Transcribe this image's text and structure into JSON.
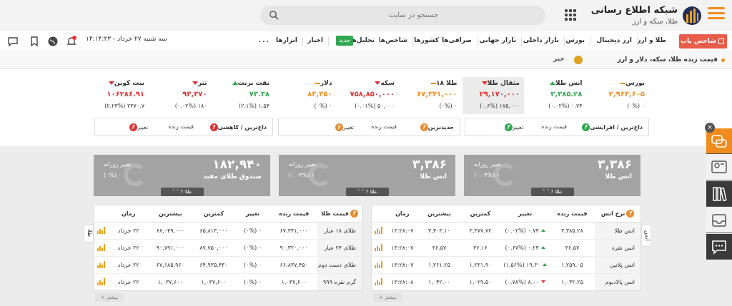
{
  "header": {
    "logo_title": "شبکه اطلاع رسانی",
    "logo_subtitle": "طلا، سکه و ارز",
    "search_placeholder": "جستجو در سایت"
  },
  "nav": {
    "shakhes_label": "شاخص یاب",
    "items": [
      "طلا و ارز",
      "ارز دیجیتال",
      "بورس",
      "بازار داخلی",
      "بازار جهانی",
      "صرافی‌ها",
      "کشورها",
      "شاخص‌ها",
      "تحلیل‌ها",
      "اخبار",
      "ابزارها"
    ],
    "new_badge": "جدید",
    "more": "...",
    "date": "سه شنبه ۲۷ خرداد - ۱۴:۱۴:۲۳"
  },
  "ticker": {
    "text": "قیمت زنده طلا، سکه، دلار و ارز",
    "news_label": "خبر"
  },
  "cards": [
    {
      "title": "بورس",
      "value": "۲,۹۶۳,۶۰۵",
      "sub": "(۰%) ۰",
      "dir": "flat"
    },
    {
      "title": "انس طلا",
      "value": "۳,۳۸۵.۲۸",
      "sub": "(۰.۰۲%) ۰.۷۴",
      "dir": "up"
    },
    {
      "title": "مثقال طلا",
      "value": "۲۹,۱۷۰,۰۰۰",
      "sub": "(۰.۶%) ۱۷۵,۰۰۰",
      "dir": "down",
      "selected": true
    },
    {
      "title": "طلا ۱۸",
      "value": "۶۷,۳۴۱,۰۰۰",
      "sub": "(۰%) ۰",
      "dir": "flat"
    },
    {
      "title": "سکه",
      "value": "۷۵۸,۸۵۰,۰۰۰",
      "sub": "(۰.۰۱%) ۵۰,۰۰۰",
      "dir": "down"
    },
    {
      "title": "دلار",
      "value": "۸۳,۳۵۰",
      "sub": "(۰%) ۰",
      "dir": "flat"
    },
    {
      "title": "نفت برنت",
      "value": "۷۳.۳۸",
      "sub": "(۲.۱%) ۱.۵۴",
      "dir": "up"
    },
    {
      "title": "تتر",
      "value": "۹۳,۳۷۰",
      "sub": "(۰.۰۲%) ۱۸۰",
      "dir": "down"
    },
    {
      "title": "بیت کوین",
      "value": "۱۰۶۲۸۶.۹۱",
      "sub": "(۲.۲۳%) ۲۳۷۰.۷",
      "dir": "down"
    }
  ],
  "filters": {
    "box1": {
      "title": "داغ‌ترین / افزایشی",
      "change": "تغییر",
      "price": "قیمت زنده"
    },
    "box2": {
      "title": "جدیدترین",
      "change": "تغییر",
      "price": "قیمت زنده"
    },
    "box3": {
      "title": "داغ‌ترین / کاهشی",
      "change": "تغییر",
      "price": "قیمت زنده"
    }
  },
  "big_cards": [
    {
      "value": "۳,۳۸۶",
      "name": "انس طلا",
      "label": "تغییر روزانه",
      "change": "(۰.۰۴%) ۱",
      "ctl": "طلا"
    },
    {
      "value": "۳,۳۸۶",
      "name": "انس طلا",
      "label": "تغییر روزانه",
      "change": "(۰.۰۴%) ۱",
      "ctl": "طلا"
    },
    {
      "value": "۱۸۲,۹۴۰",
      "name": "صندوق طلای مفید",
      "label": "تغییر روزانه",
      "change": "(۰%) ۰",
      "ctl": "طلا"
    }
  ],
  "table_ons": {
    "side_tab": "انس",
    "headers": [
      "نرخ انس",
      "قیمت زنده",
      "تغییر",
      "کمترین",
      "بیشترین",
      "زمان"
    ],
    "rows": [
      [
        "انس طلا",
        "۳,۳۸۵.۲۸",
        "(۰.۰۲%) ۰.۷۴",
        "۳,۳۷۷.۷۲",
        "۳,۴۰۳.۱۰",
        "۱۳:۲۸:۰۷",
        "up"
      ],
      [
        "انس نقره",
        "۳۶.۵۷",
        "(۰.۶۷%) ۰.۲۴",
        "۳۶.۱۶",
        "۳۶.۵۷",
        "۱۳:۲۸:۰۷",
        "up"
      ],
      [
        "انس پلاتین",
        "۱,۲۵۹.۰۵",
        "(۱.۵۶%) ۱۹.۳۰",
        "۱,۲۳۱.۹۰",
        "۱,۲۶۱.۲۵",
        "۱۳:۲۸:۰۷",
        "up"
      ],
      [
        "انس پالادیوم",
        "۱,۰۳۲.۲۵",
        "(۰.۷۸%) ۸.۰۰",
        "۱,۰۲۹.۵۰",
        "۱,۰۴۲.۰۰",
        "۱۳:۲۸:۰۸",
        "down"
      ]
    ],
    "more": "بیشتر"
  },
  "table_gold": {
    "side_tab": "طلا",
    "headers": [
      "قیمت طلا",
      "قیمت زنده",
      "تغییر",
      "کمترین",
      "بیشترین",
      "زمان"
    ],
    "rows": [
      [
        "طلای ۱۸ عیار",
        "۶۷,۳۴۱,۰۰۰",
        "(۰%) ۰",
        "۶۵,۸۱۳,۰۰۰",
        "۶۸,۰۴۹,۰۰۰",
        "۲۲ خرداد",
        "flat"
      ],
      [
        "طلای ۲۴ عیار",
        "۹۰,۳۲۰,۰۰۰",
        "(۰%) ۰",
        "۸۷,۷۵۰,۰۰۰",
        "۹۰,۷۹۱,۰۰۰",
        "۲۲ خرداد",
        "flat"
      ],
      [
        "طلای دست دوم",
        "۶۶,۸۳۷,۴۵۰",
        "(۰%) ۰",
        "۶۴,۹۳۵,۴۳۰",
        "۶۷,۱۸۵,۹۶۰",
        "۲۲ خرداد",
        "flat"
      ],
      [
        "گرم نقره ۹۹۹",
        "۱,۰۳۷,۶۰۰",
        "(۰%) ۰",
        "۱,۰۳۷,۶۰۰",
        "۱,۰۳۷,۶۰۰",
        "۲۲ خرداد",
        "flat"
      ]
    ],
    "more": "بیشتر"
  },
  "colors": {
    "accent": "#f08c1e",
    "up": "#2fa84f",
    "down": "#d33333",
    "danger": "#e85c4a"
  }
}
